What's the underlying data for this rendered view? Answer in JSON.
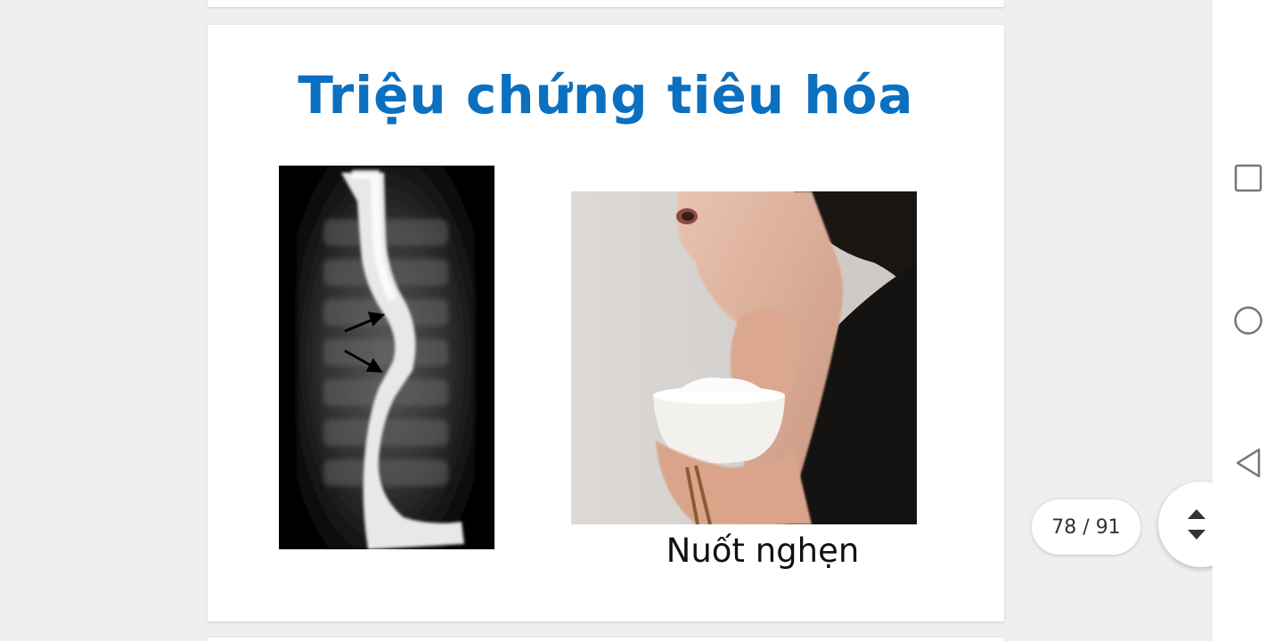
{
  "slide": {
    "title": "Triệu chứng tiêu hóa",
    "caption": "Nuốt nghẹn",
    "title_color": "#0b70c0"
  },
  "viewer": {
    "page_indicator": "78 / 91",
    "scroll_handle_icon": "scroll-updown-icon"
  },
  "system_nav": {
    "recents_icon": "square-recents-icon",
    "home_icon": "circle-home-icon",
    "back_icon": "triangle-back-icon"
  }
}
